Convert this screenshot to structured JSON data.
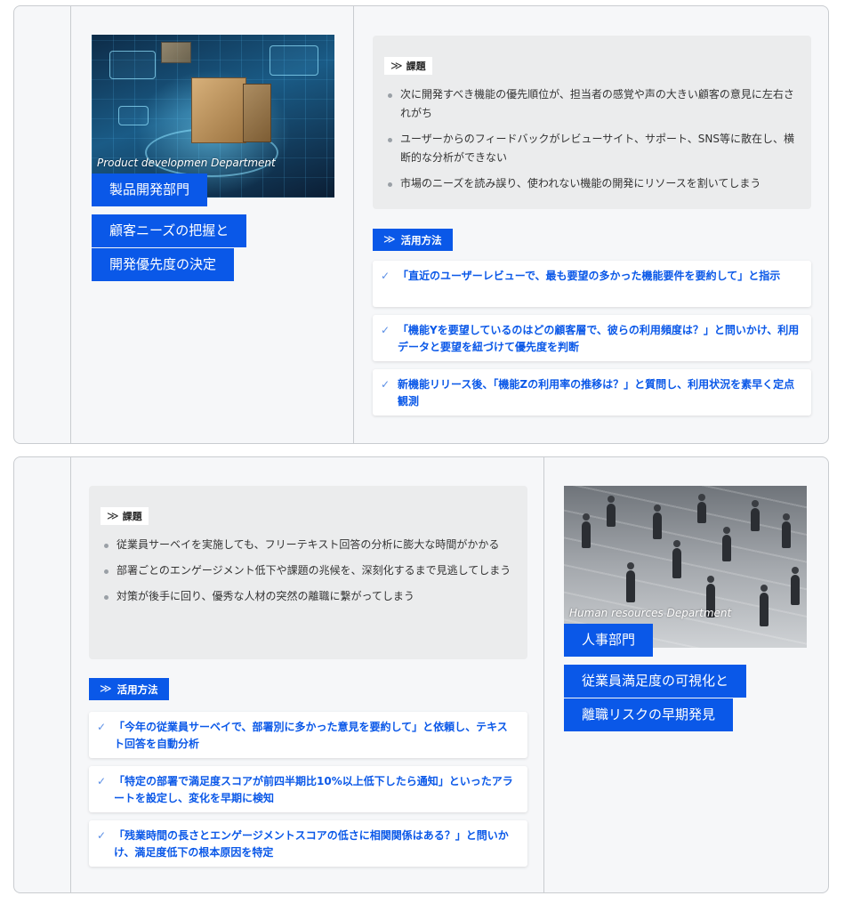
{
  "sections": [
    {
      "image_caption": "Product developmen Department",
      "department": "製品開発部門",
      "title_lines": [
        "顧客ニーズの把握と",
        "開発優先度の決定"
      ],
      "issues_label": "課題",
      "issues": [
        "次に開発すべき機能の優先順位が、担当者の感覚や声の大きい顧客の意見に左右されがち",
        "ユーザーからのフィードバックがレビューサイト、サポート、SNS等に散在し、横断的な分析ができない",
        "市場のニーズを読み誤り、使われない機能の開発にリソースを割いてしまう"
      ],
      "usage_label": "活用方法",
      "usage": [
        "「直近のユーザーレビューで、最も要望の多かった機能要件を要約して」と指示",
        "「機能Yを要望しているのはどの顧客層で、彼らの利用頻度は？」と問いかけ、利用データと要望を紐づけて優先度を判断",
        "新機能リリース後、「機能Zの利用率の推移は？」と質問し、利用状況を素早く定点観測"
      ]
    },
    {
      "image_caption": "Human resources Department",
      "department": "人事部門",
      "title_lines": [
        "従業員満足度の可視化と",
        "離職リスクの早期発見"
      ],
      "issues_label": "課題",
      "issues": [
        "従業員サーベイを実施しても、フリーテキスト回答の分析に膨大な時間がかかる",
        "部署ごとのエンゲージメント低下や課題の兆候を、深刻化するまで見逃してしまう",
        "対策が後手に回り、優秀な人材の突然の離職に繋がってしまう"
      ],
      "usage_label": "活用方法",
      "usage": [
        "「今年の従業員サーベイで、部署別に多かった意見を要約して」と依頼し、テキスト回答を自動分析",
        "「特定の部署で満足度スコアが前四半期比10%以上低下したら通知」といったアラートを設定し、変化を早期に検知",
        "「残業時間の長さとエンゲージメントスコアの低さに相関関係はある？」と問いかけ、満足度低下の根本原因を特定"
      ]
    }
  ],
  "icons": {
    "section_marker": "double-chevron-right-icon",
    "bullet": "dot-icon",
    "check": "check-icon"
  },
  "colors": {
    "accent": "#0a58e8",
    "card_bg": "#f6f7f9",
    "issues_bg": "#ebeced"
  }
}
